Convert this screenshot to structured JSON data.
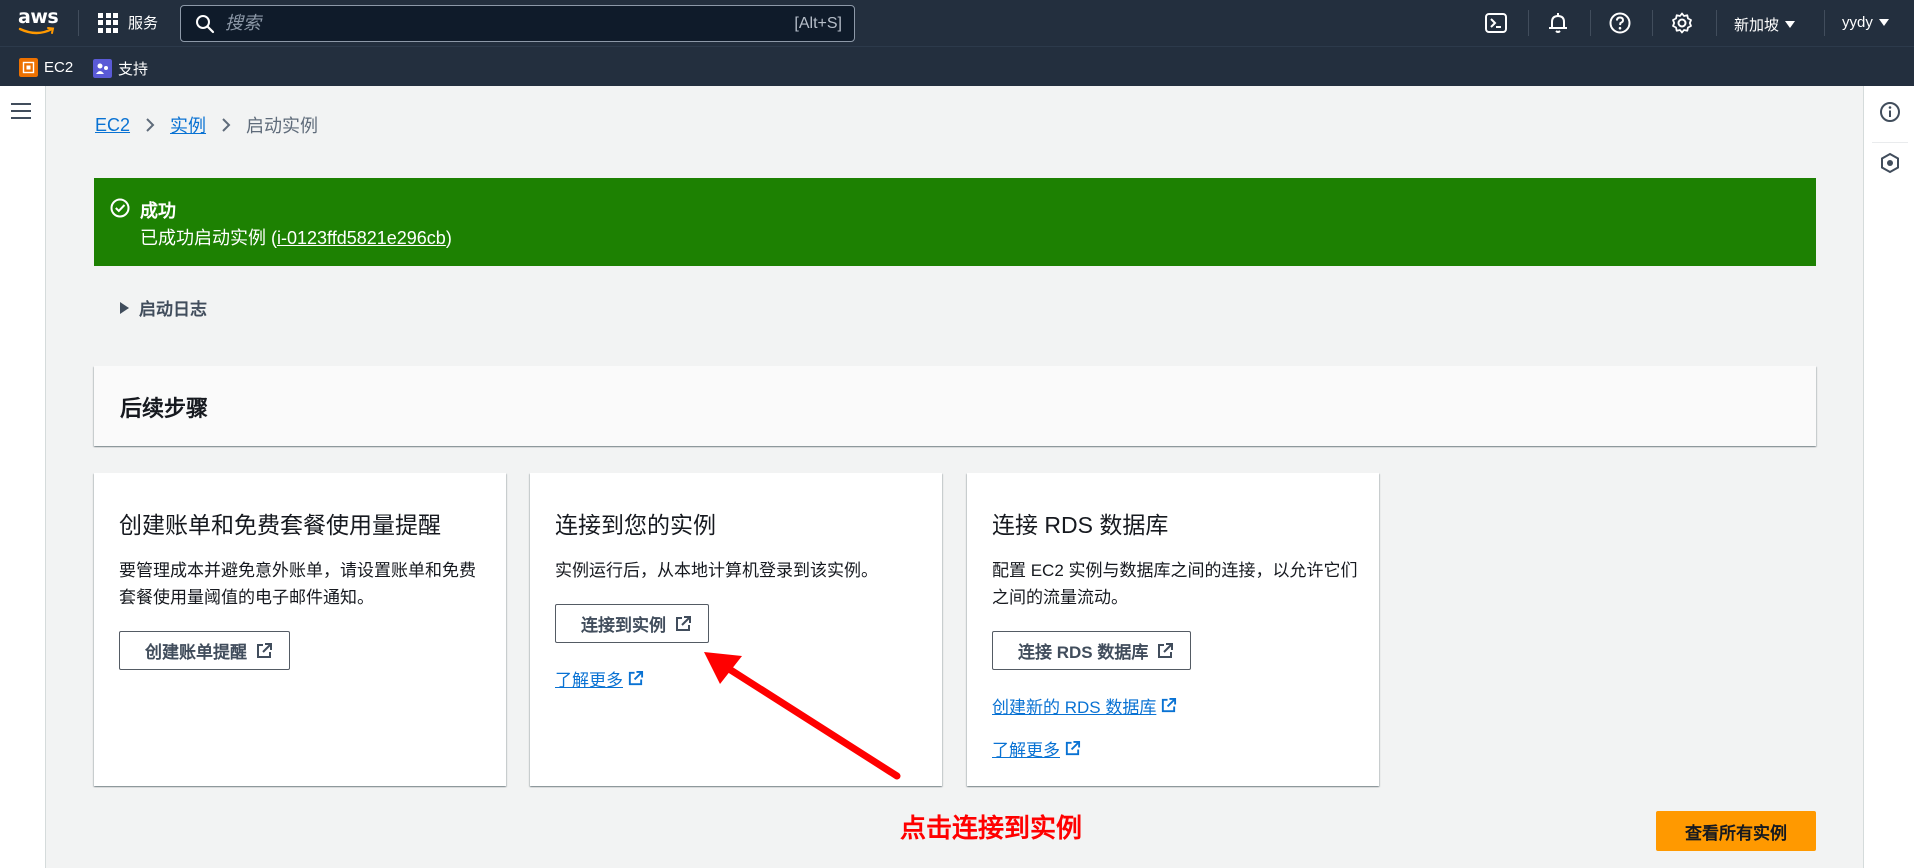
{
  "topnav": {
    "logo_text": "aws",
    "services_label": "服务",
    "search_placeholder": "搜索",
    "search_shortcut": "[Alt+S]",
    "region": "新加坡",
    "user": "yydy"
  },
  "favorites": [
    {
      "label": "EC2",
      "color": "#ed7100"
    },
    {
      "label": "支持",
      "color": "#5a5ad6"
    }
  ],
  "breadcrumb": {
    "items": [
      "EC2",
      "实例"
    ],
    "current": "启动实例"
  },
  "flash": {
    "title": "成功",
    "message_prefix": "已成功启动实例 (",
    "instance_id": "i-0123ffd5821e296cb",
    "message_suffix": ")"
  },
  "launch_log": "启动日志",
  "next_steps": {
    "title": "后续步骤",
    "cards": [
      {
        "title": "创建账单和免费套餐使用量提醒",
        "description": "要管理成本并避免意外账单，请设置账单和免费套餐使用量阈值的电子邮件通知。",
        "button": "创建账单提醒"
      },
      {
        "title": "连接到您的实例",
        "description": "实例运行后，从本地计算机登录到该实例。",
        "button": "连接到实例",
        "link": "了解更多"
      },
      {
        "title": "连接 RDS 数据库",
        "description": "配置 EC2 实例与数据库之间的连接，以允许它们之间的流量流动。",
        "button": "连接 RDS 数据库",
        "link1": "创建新的 RDS 数据库",
        "link2": "了解更多"
      }
    ]
  },
  "annotation": "点击连接到实例",
  "view_all_button": "查看所有实例",
  "colors": {
    "nav_bg": "#232f3e",
    "success": "#1d8102",
    "link": "#0972d3",
    "primary": "#ff9900",
    "annotation": "#ff0000"
  }
}
